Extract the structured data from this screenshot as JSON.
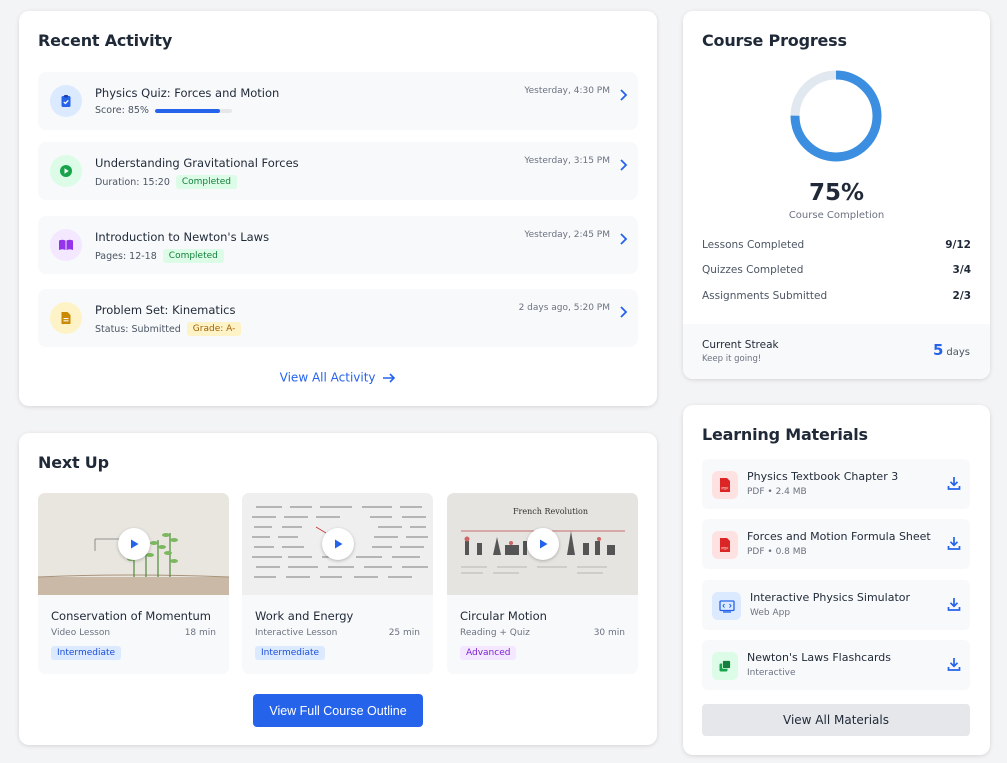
{
  "recent_activity": {
    "title": "Recent Activity",
    "items": [
      {
        "title": "Physics Quiz: Forces and Motion",
        "sub": "Score: 85%",
        "progress": 0.85,
        "time": "Yesterday, 4:30 PM",
        "icon": "clipboard-check-icon"
      },
      {
        "title": "Understanding Gravitational Forces",
        "sub": "Duration: 15:20",
        "tag": "Completed",
        "time": "Yesterday, 3:15 PM",
        "icon": "play-circle-icon"
      },
      {
        "title": "Introduction to Newton's Laws",
        "sub": "Pages: 12-18",
        "tag": "Completed",
        "time": "Yesterday, 2:45 PM",
        "icon": "book-open-icon"
      },
      {
        "title": "Problem Set: Kinematics",
        "sub": "Status: Submitted",
        "tag": "Grade: A-",
        "time": "2 days ago, 5:20 PM",
        "icon": "document-icon"
      }
    ],
    "view_all": "View All Activity"
  },
  "next_up": {
    "title": "Next Up",
    "courses": [
      {
        "title": "Conservation of Momentum",
        "type": "Video Lesson",
        "duration": "18 min",
        "level": "Intermediate"
      },
      {
        "title": "Work and Energy",
        "type": "Interactive Lesson",
        "duration": "25 min",
        "level": "Intermediate"
      },
      {
        "title": "Circular Motion",
        "type": "Reading + Quiz",
        "duration": "30 min",
        "level": "Advanced",
        "thumb_text": "French Revolution"
      }
    ],
    "button": "View Full Course Outline"
  },
  "course_progress": {
    "title": "Course Progress",
    "percent": 75,
    "percent_label": "75%",
    "completion_label": "Course Completion",
    "stats": [
      {
        "label": "Lessons Completed",
        "value": "9/12"
      },
      {
        "label": "Quizzes Completed",
        "value": "3/4"
      },
      {
        "label": "Assignments Submitted",
        "value": "2/3"
      }
    ],
    "streak": {
      "title": "Current Streak",
      "subtitle": "Keep it going!",
      "value": "5",
      "unit": "days"
    }
  },
  "learning_materials": {
    "title": "Learning Materials",
    "items": [
      {
        "title": "Physics Textbook Chapter 3",
        "sub": "PDF • 2.4 MB",
        "icon": "pdf-icon",
        "icon_label": "PDF"
      },
      {
        "title": "Forces and Motion Formula Sheet",
        "sub": "PDF • 0.8 MB",
        "icon": "pdf-icon",
        "icon_label": "PDF"
      },
      {
        "title": "Interactive Physics Simulator",
        "sub": "Web App",
        "icon": "code-window-icon",
        "icon_label": ""
      },
      {
        "title": "Newton's Laws Flashcards",
        "sub": "Interactive",
        "icon": "cards-icon",
        "icon_label": ""
      }
    ],
    "button": "View All Materials"
  },
  "colors": {
    "accent": "#2563eb",
    "donut_track": "#e2e8f0",
    "donut_fill": "#3b8ee0"
  }
}
